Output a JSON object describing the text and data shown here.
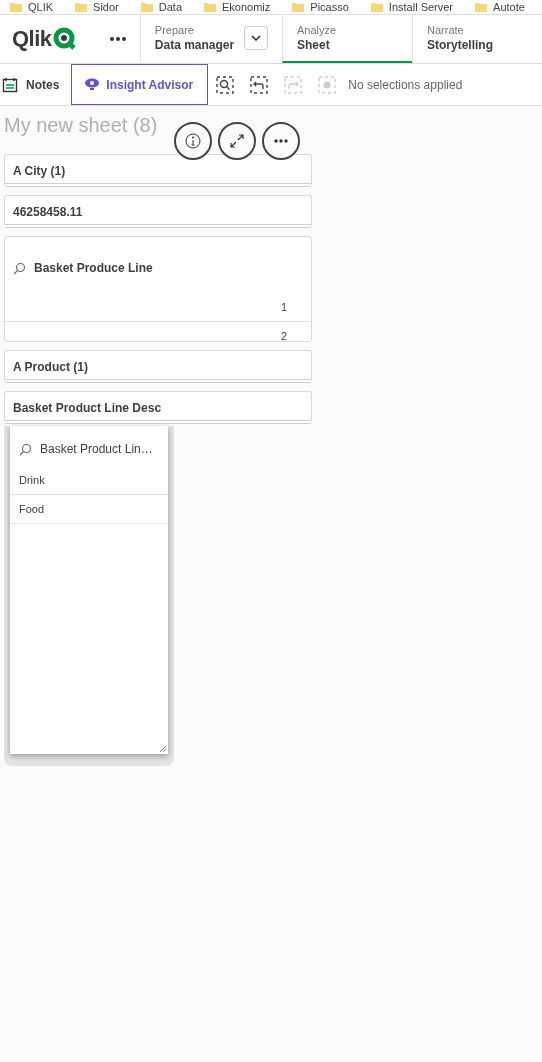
{
  "bookmarks": [
    {
      "label": "QLIK"
    },
    {
      "label": "Sidor"
    },
    {
      "label": "Data"
    },
    {
      "label": "Ekonomiz"
    },
    {
      "label": "Picasso"
    },
    {
      "label": "Install Server"
    },
    {
      "label": "Autote"
    }
  ],
  "header": {
    "logo": "Qlik",
    "tabs": [
      {
        "caption": "Prepare",
        "label": "Data manager",
        "selected": false,
        "has_menu": true
      },
      {
        "caption": "Analyze",
        "label": "Sheet",
        "selected": true,
        "has_menu": false
      },
      {
        "caption": "Narrate",
        "label": "Storytelling",
        "selected": false,
        "has_menu": false
      }
    ]
  },
  "toolbar": {
    "notes": "Notes",
    "insight_advisor": "Insight Advisor",
    "tools": [
      {
        "kind": "search",
        "disabled": false
      },
      {
        "kind": "back",
        "disabled": false
      },
      {
        "kind": "forward",
        "disabled": true
      },
      {
        "kind": "clear",
        "disabled": true
      }
    ],
    "selections": "No selections applied"
  },
  "sheet": {
    "title": "My new sheet (8)",
    "actions": [
      {
        "kind": "info"
      },
      {
        "kind": "expand"
      },
      {
        "kind": "more"
      }
    ],
    "cards": [
      {
        "kind": "filter",
        "title": "A City (1)"
      },
      {
        "kind": "filter",
        "title": "46258458.11"
      },
      {
        "kind": "listbox",
        "title": "Basket Produce Line",
        "rows": [
          "1",
          "2"
        ]
      },
      {
        "kind": "filter",
        "title": "A Product (1)"
      },
      {
        "kind": "filter",
        "title": "Basket Product Line Desc"
      }
    ],
    "popup": {
      "title": "Basket Product Lin…",
      "items": [
        "Drink",
        "Food"
      ]
    }
  }
}
